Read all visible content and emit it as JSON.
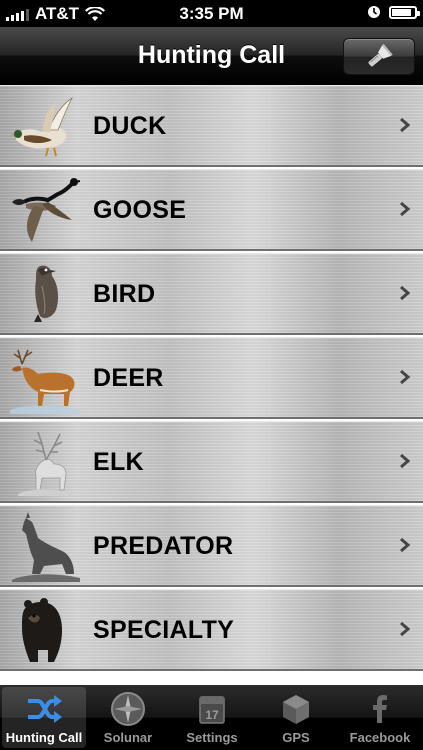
{
  "status_bar": {
    "carrier": "AT&T",
    "time": "3:35 PM",
    "battery_level": 0.85
  },
  "nav": {
    "title": "Hunting Call",
    "flashlight_icon": "flashlight-icon"
  },
  "categories": [
    {
      "label": "DUCK",
      "icon": "duck-icon"
    },
    {
      "label": "GOOSE",
      "icon": "goose-icon"
    },
    {
      "label": "BIRD",
      "icon": "bird-icon"
    },
    {
      "label": "DEER",
      "icon": "deer-icon"
    },
    {
      "label": "ELK",
      "icon": "elk-icon"
    },
    {
      "label": "PREDATOR",
      "icon": "wolf-icon"
    },
    {
      "label": "SPECIALTY",
      "icon": "bear-icon"
    }
  ],
  "tabs": [
    {
      "label": "Hunting Call",
      "icon": "shuffle-icon",
      "active": true
    },
    {
      "label": "Solunar",
      "icon": "compass-icon",
      "active": false
    },
    {
      "label": "Settings",
      "icon": "calendar-icon",
      "active": false
    },
    {
      "label": "GPS",
      "icon": "cube-icon",
      "active": false
    },
    {
      "label": "Facebook",
      "icon": "facebook-icon",
      "active": false
    }
  ],
  "colors": {
    "active_tab_icon": "#3a8ee6"
  }
}
